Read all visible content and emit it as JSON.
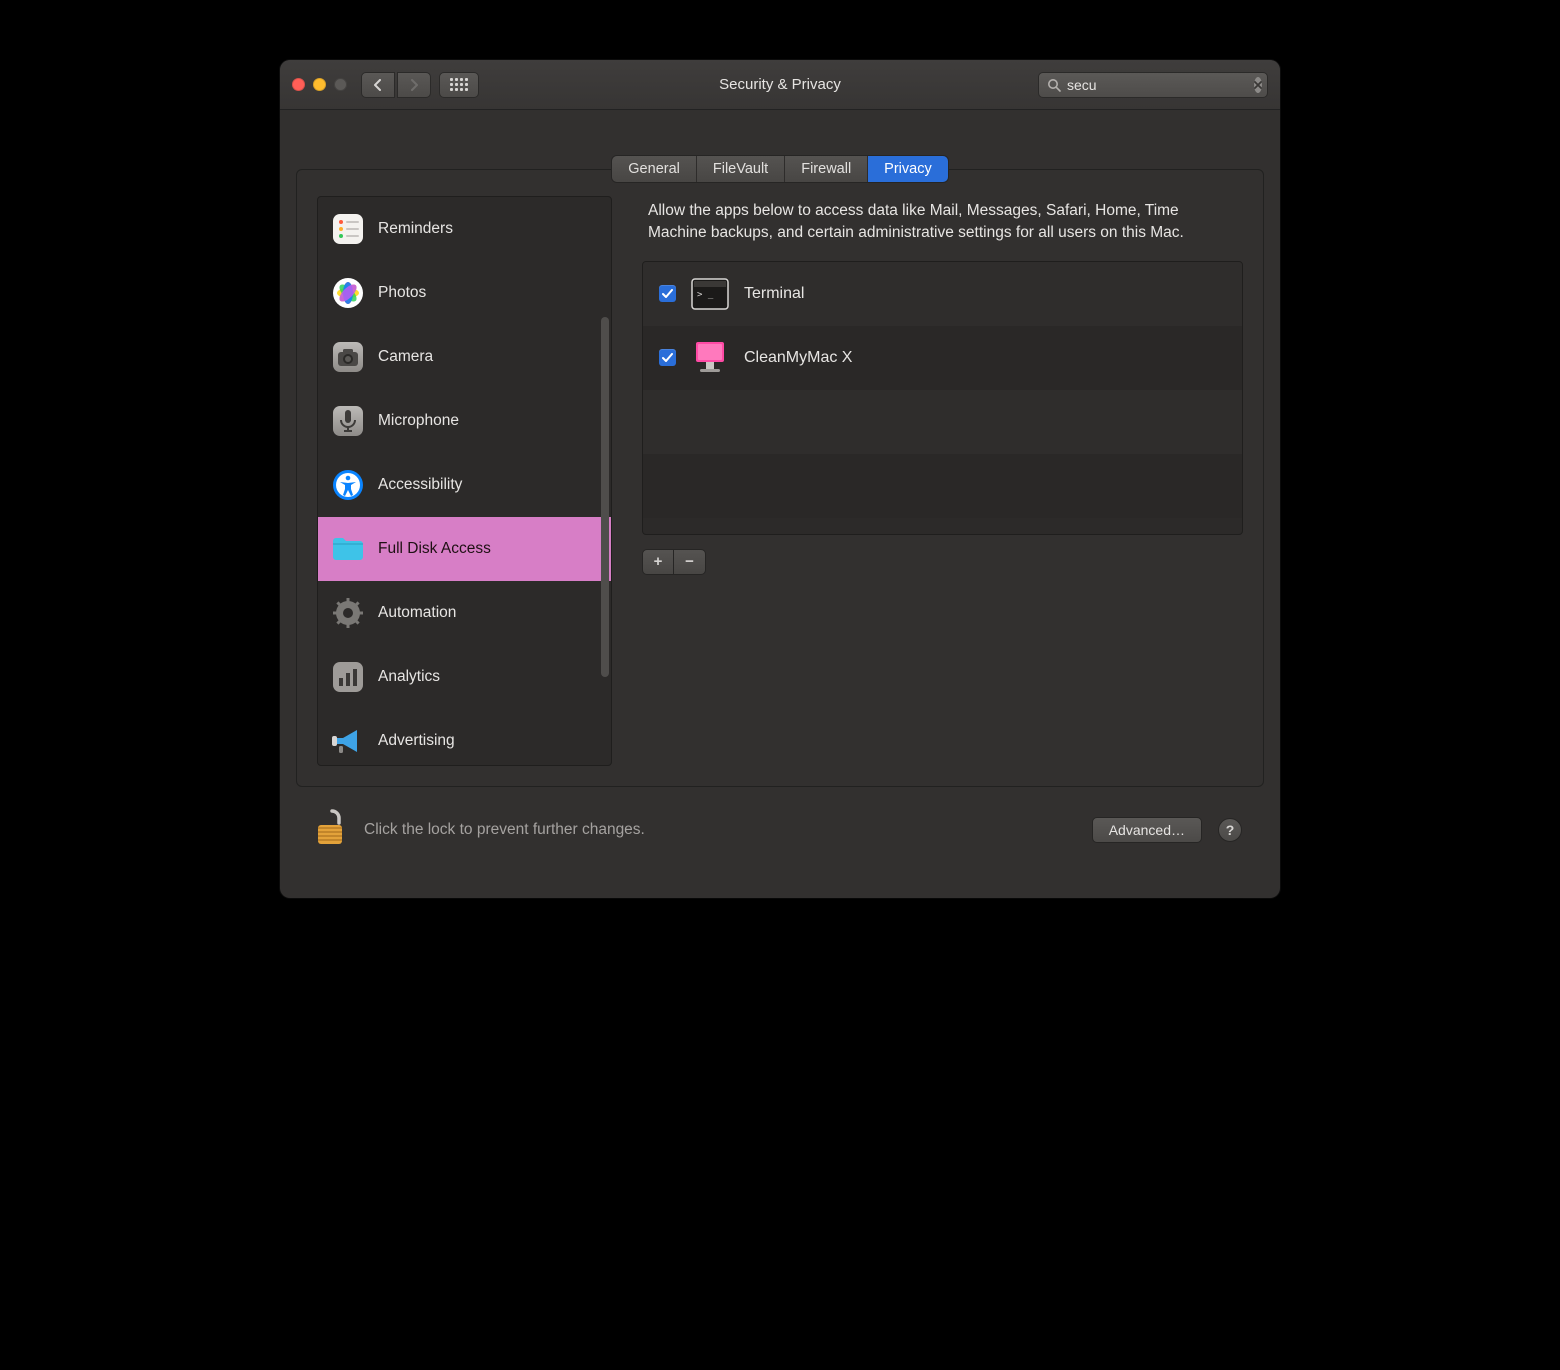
{
  "window": {
    "title": "Security & Privacy"
  },
  "search": {
    "value": "secu"
  },
  "tabs": [
    {
      "label": "General",
      "active": false
    },
    {
      "label": "FileVault",
      "active": false
    },
    {
      "label": "Firewall",
      "active": false
    },
    {
      "label": "Privacy",
      "active": true
    }
  ],
  "sidebar": {
    "items": [
      {
        "label": "Reminders",
        "icon": "reminders",
        "selected": false
      },
      {
        "label": "Photos",
        "icon": "photos",
        "selected": false
      },
      {
        "label": "Camera",
        "icon": "camera",
        "selected": false
      },
      {
        "label": "Microphone",
        "icon": "microphone",
        "selected": false
      },
      {
        "label": "Accessibility",
        "icon": "accessibility",
        "selected": false
      },
      {
        "label": "Full Disk Access",
        "icon": "folder",
        "selected": true
      },
      {
        "label": "Automation",
        "icon": "gear",
        "selected": false
      },
      {
        "label": "Analytics",
        "icon": "analytics",
        "selected": false
      },
      {
        "label": "Advertising",
        "icon": "advertising",
        "selected": false
      }
    ]
  },
  "main": {
    "description": "Allow the apps below to access data like Mail, Messages, Safari, Home, Time Machine backups, and certain administrative settings for all users on this Mac.",
    "apps": [
      {
        "name": "Terminal",
        "checked": true,
        "icon": "terminal"
      },
      {
        "name": "CleanMyMac X",
        "checked": true,
        "icon": "cleanmymac"
      }
    ],
    "add_label": "+",
    "remove_label": "−"
  },
  "footer": {
    "lock_text": "Click the lock to prevent further changes.",
    "advanced_label": "Advanced…",
    "help_label": "?"
  }
}
